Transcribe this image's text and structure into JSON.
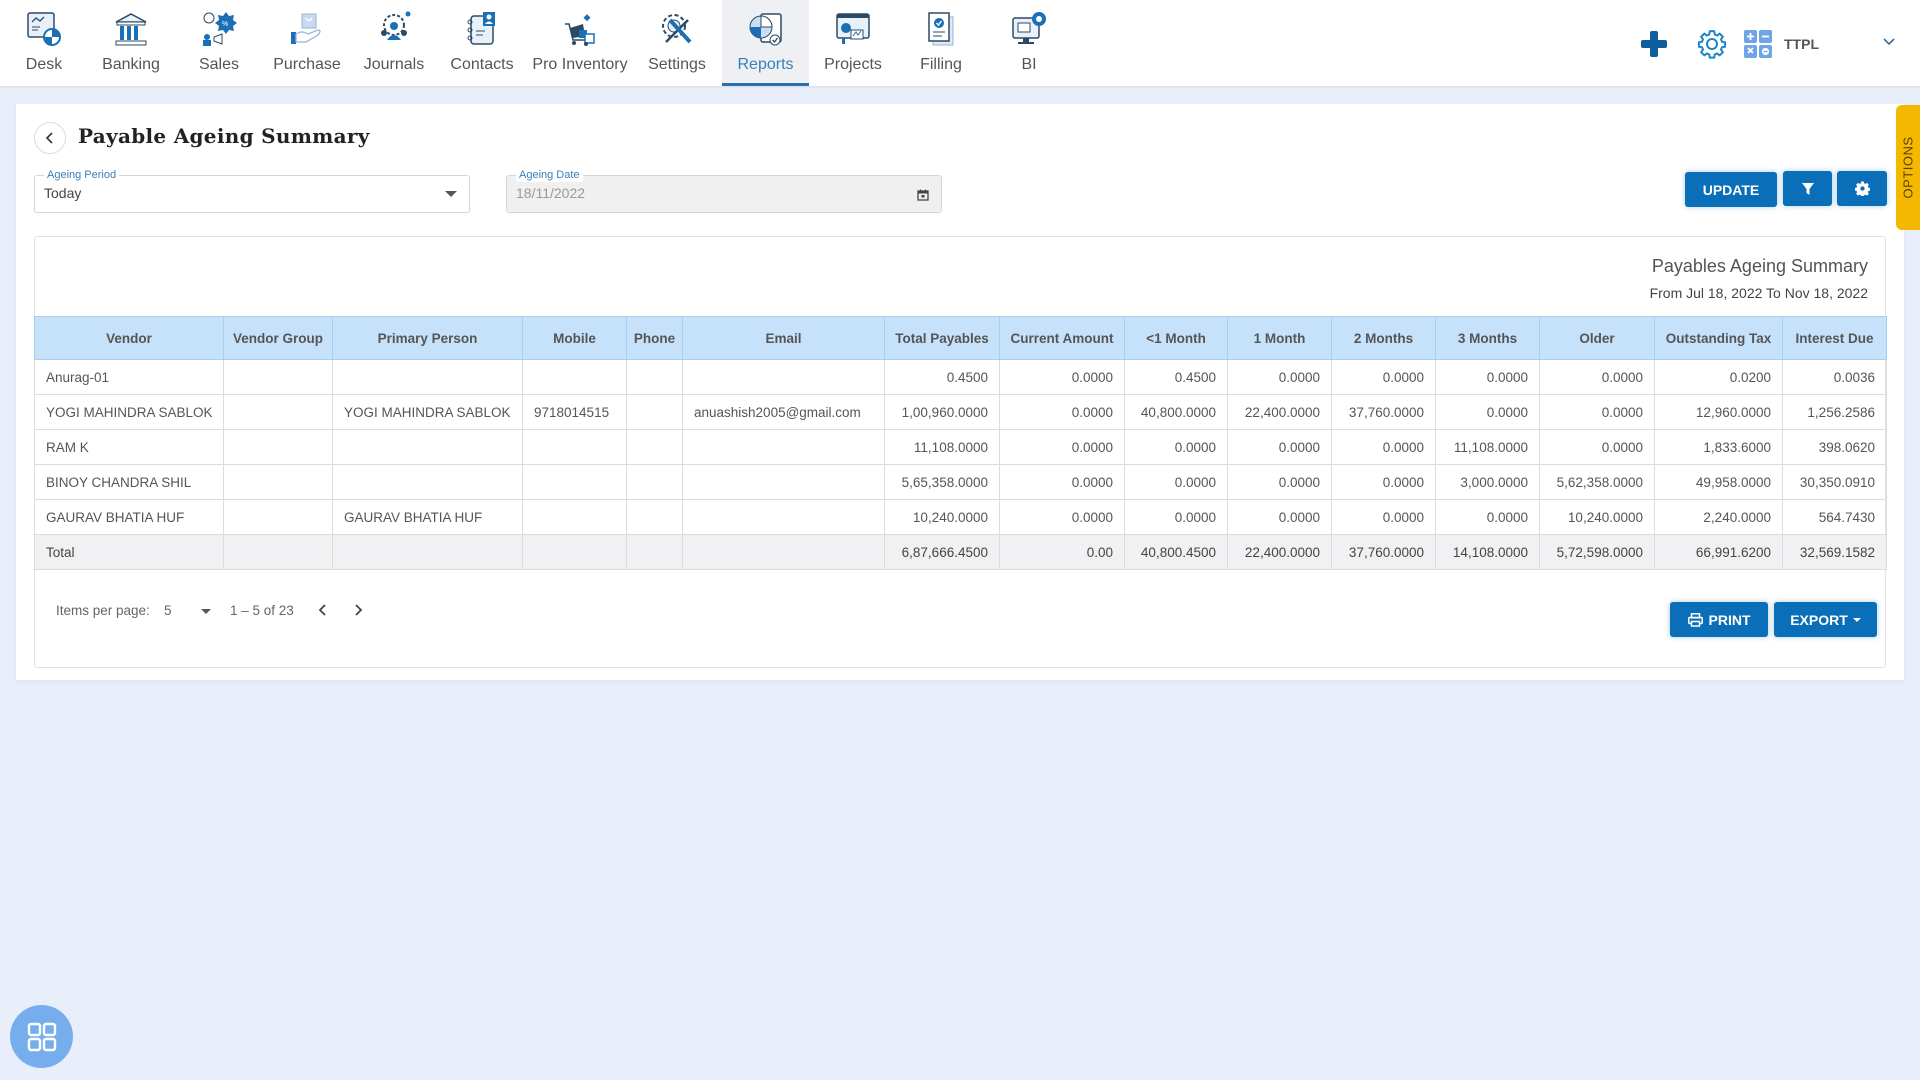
{
  "nav": {
    "items": [
      {
        "label": "Desk",
        "icon": "desk-icon"
      },
      {
        "label": "Banking",
        "icon": "bank-icon"
      },
      {
        "label": "Sales",
        "icon": "sales-icon"
      },
      {
        "label": "Purchase",
        "icon": "purchase-icon"
      },
      {
        "label": "Journals",
        "icon": "journals-icon"
      },
      {
        "label": "Contacts",
        "icon": "contacts-icon"
      },
      {
        "label": "Pro Inventory",
        "icon": "inventory-icon"
      },
      {
        "label": "Settings",
        "icon": "settings-tools-icon"
      },
      {
        "label": "Reports",
        "icon": "reports-icon",
        "active": true
      },
      {
        "label": "Projects",
        "icon": "projects-icon"
      },
      {
        "label": "Filling",
        "icon": "filling-icon"
      },
      {
        "label": "BI",
        "icon": "bi-icon"
      }
    ],
    "company": "TTPL",
    "accent": "#2b72ad"
  },
  "page": {
    "title": "Payable Ageing Summary",
    "ageing_period_label": "Ageing Period",
    "ageing_period_value": "Today",
    "ageing_date_label": "Ageing Date",
    "ageing_date_value": "18/11/2022",
    "update_label": "UPDATE",
    "options_label": "OPTIONS"
  },
  "report": {
    "title": "Payables Ageing Summary",
    "subtitle": "From Jul 18, 2022 To Nov 18, 2022",
    "columns": [
      "Vendor",
      "Vendor Group",
      "Primary Person",
      "Mobile",
      "Phone",
      "Email",
      "Total Payables",
      "Current Amount",
      "<1 Month",
      "1 Month",
      "2 Months",
      "3 Months",
      "Older",
      "Outstanding Tax",
      "Interest Due"
    ],
    "rows": [
      [
        "Anurag-01",
        "",
        "",
        "",
        "",
        "",
        "0.4500",
        "0.0000",
        "0.4500",
        "0.0000",
        "0.0000",
        "0.0000",
        "0.0000",
        "0.0200",
        "0.0036"
      ],
      [
        "YOGI MAHINDRA SABLOK",
        "",
        "YOGI MAHINDRA SABLOK",
        "9718014515",
        "",
        "anuashish2005@gmail.com",
        "1,00,960.0000",
        "0.0000",
        "40,800.0000",
        "22,400.0000",
        "37,760.0000",
        "0.0000",
        "0.0000",
        "12,960.0000",
        "1,256.2586"
      ],
      [
        "RAM K",
        "",
        "",
        "",
        "",
        "",
        "11,108.0000",
        "0.0000",
        "0.0000",
        "0.0000",
        "0.0000",
        "11,108.0000",
        "0.0000",
        "1,833.6000",
        "398.0620"
      ],
      [
        "BINOY CHANDRA SHIL",
        "",
        "",
        "",
        "",
        "",
        "5,65,358.0000",
        "0.0000",
        "0.0000",
        "0.0000",
        "0.0000",
        "3,000.0000",
        "5,62,358.0000",
        "49,958.0000",
        "30,350.0910"
      ],
      [
        "GAURAV BHATIA HUF",
        "",
        "GAURAV BHATIA HUF",
        "",
        "",
        "",
        "10,240.0000",
        "0.0000",
        "0.0000",
        "0.0000",
        "0.0000",
        "0.0000",
        "10,240.0000",
        "2,240.0000",
        "564.7430"
      ]
    ],
    "total": [
      "Total",
      "",
      "",
      "",
      "",
      "",
      "6,87,666.4500",
      "0.00",
      "40,800.4500",
      "22,400.0000",
      "37,760.0000",
      "14,108.0000",
      "5,72,598.0000",
      "66,991.6200",
      "32,569.1582"
    ]
  },
  "pager": {
    "items_per_page_label": "Items per page:",
    "items_per_page_value": "5",
    "range": "1 – 5 of 23"
  },
  "actions": {
    "print_label": "PRINT",
    "export_label": "EXPORT"
  }
}
